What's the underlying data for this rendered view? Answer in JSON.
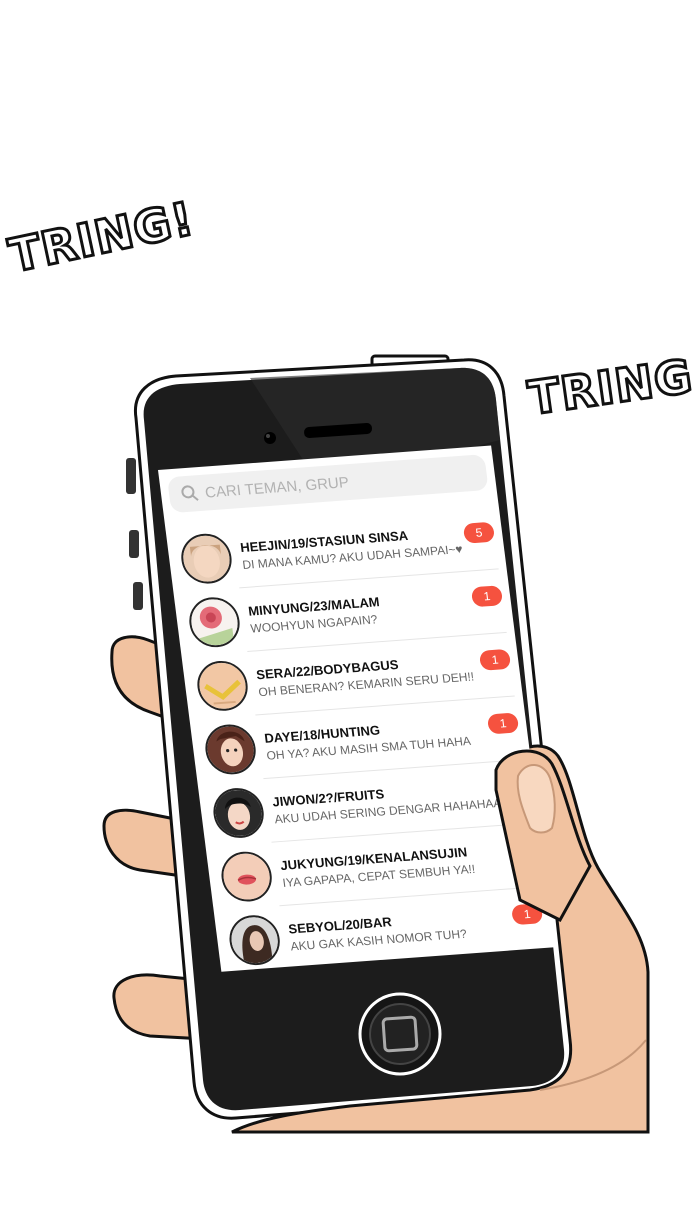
{
  "sfx": [
    "TRING!",
    "TRING"
  ],
  "search": {
    "placeholder": "CARI TEMAN, GRUP"
  },
  "chats": [
    {
      "name": "HEEJIN/19/STASIUN SINSA",
      "message": "DI MANA KAMU? AKU UDAH SAMPAI~♥",
      "unread": "5"
    },
    {
      "name": "MINYUNG/23/MALAM",
      "message": "WOOHYUN NGAPAIN?",
      "unread": "1"
    },
    {
      "name": "SERA/22/BODYBAGUS",
      "message": "OH BENERAN? KEMARIN SERU DEH!!",
      "unread": "1"
    },
    {
      "name": "DAYE/18/HUNTING",
      "message": "OH YA? AKU MASIH SMA TUH HAHA",
      "unread": "1"
    },
    {
      "name": "JIWON/2?/FRUITS",
      "message": "AKU UDAH SERING DENGAR HAHAHAA",
      "unread": ""
    },
    {
      "name": "JUKYUNG/19/KENALANSUJIN",
      "message": "IYA GAPAPA, CEPAT SEMBUH YA!!",
      "unread": ""
    },
    {
      "name": "SEBYOL/20/BAR",
      "message": "AKU GAK KASIH NOMOR TUH?",
      "unread": "1"
    }
  ],
  "colors": {
    "badge": "#f5523f",
    "skin": "#f1c2a0",
    "phone": "#1c1c1c"
  },
  "icons": {
    "search": "search-icon",
    "home": "home-button-icon"
  }
}
